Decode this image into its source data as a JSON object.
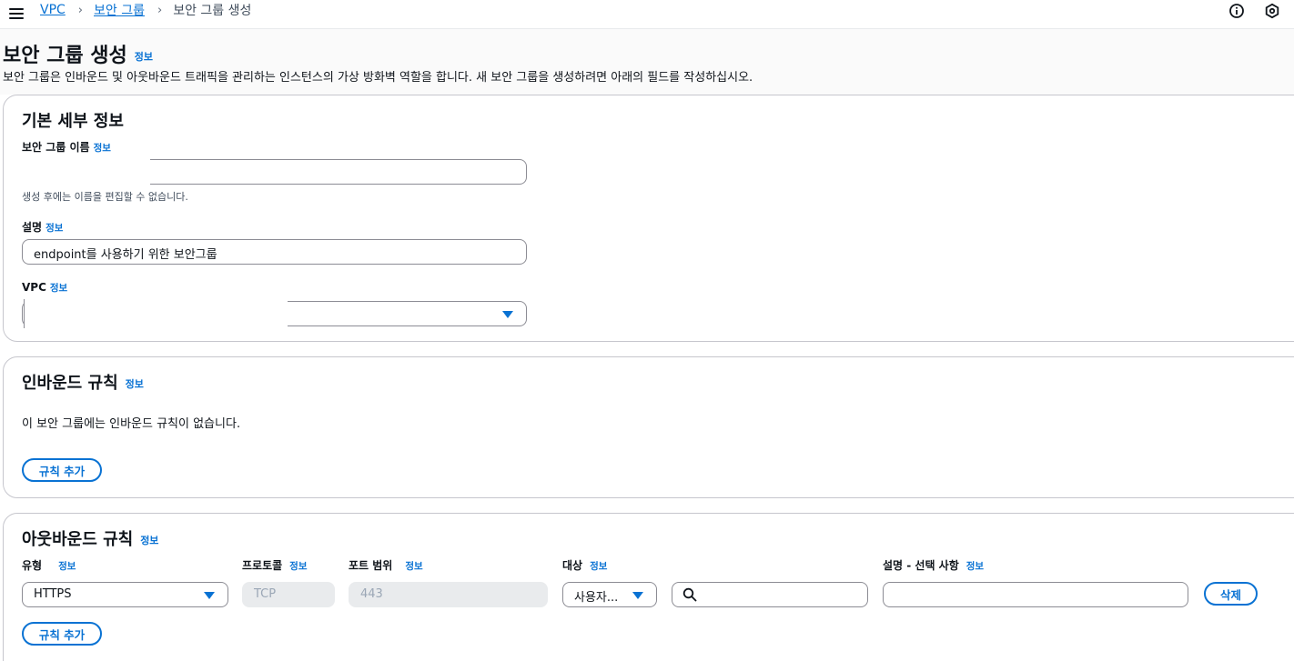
{
  "breadcrumb": {
    "items": [
      {
        "label": "VPC"
      },
      {
        "label": "보안 그룹"
      },
      {
        "label": "보안 그룹 생성"
      }
    ]
  },
  "header": {
    "title": "보안 그룹 생성",
    "info": "정보",
    "description": "보안 그룹은 인바운드 및 아웃바운드 트래픽을 관리하는 인스턴스의 가상 방화벽 역할을 합니다. 새 보안 그룹을 생성하려면 아래의 필드를 작성하십시오."
  },
  "icons": {
    "menu": "hamburger-menu-icon",
    "info": "info-circle-icon",
    "settings": "hexagon-settings-icon",
    "search": "search-icon",
    "dropdown": "caret-down-icon"
  },
  "colors": {
    "accent": "#0972d3",
    "text": "#0f141a",
    "border": "#8c8c94",
    "disabled": "#e9ebed"
  },
  "basic": {
    "title": "기본 세부 정보",
    "name_label": "보안 그룹 이름",
    "name_info": "정보",
    "name_value": "",
    "name_hint": "생성 후에는 이름을 편집할 수 없습니다.",
    "desc_label": "설명",
    "desc_info": "정보",
    "desc_value": "endpoint를 사용하기 위한 보안그룹",
    "vpc_label": "VPC",
    "vpc_info": "정보",
    "vpc_value": ""
  },
  "inbound": {
    "title": "인바운드 규칙",
    "info": "정보",
    "empty_text": "이 보안 그룹에는 인바운드 규칙이 없습니다.",
    "add_button": "규칙 추가"
  },
  "outbound": {
    "title": "아웃바운드 규칙",
    "info": "정보",
    "headers": {
      "type": "유형",
      "protocol": "프로토콜",
      "port": "포트 범위",
      "target": "대상",
      "description": "설명 - 선택 사항"
    },
    "header_info": "정보",
    "rule": {
      "type": "HTTPS",
      "protocol": "TCP",
      "port": "443",
      "target": "사용자...",
      "search": "",
      "description": ""
    },
    "delete_button": "삭제",
    "add_button": "규칙 추가"
  }
}
